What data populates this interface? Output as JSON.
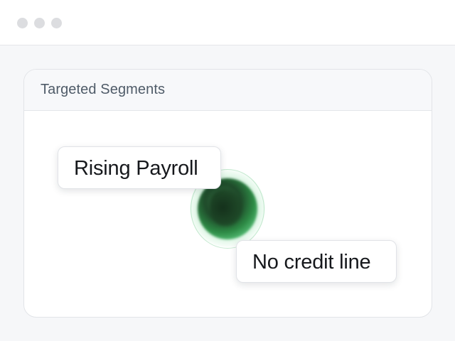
{
  "window": {
    "controls": [
      "dot",
      "dot",
      "dot"
    ]
  },
  "card": {
    "title": "Targeted Segments"
  },
  "segments": [
    {
      "label": "Rising Payroll"
    },
    {
      "label": "No credit line"
    }
  ],
  "colors": {
    "accent_green": "#2d8a45",
    "title_text": "#4f5b68",
    "tag_text": "#16181c"
  }
}
